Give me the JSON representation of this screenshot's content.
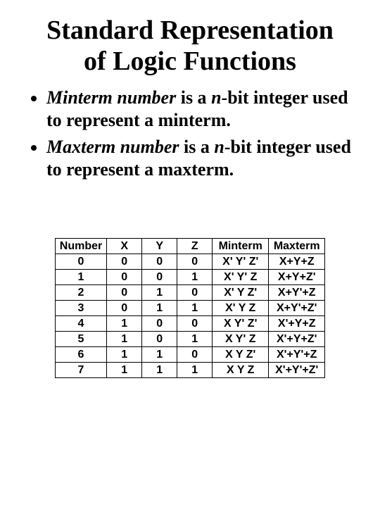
{
  "title_line1": "Standard Representation",
  "title_line2": "of Logic Functions",
  "bullet1": {
    "term": "Minterm number",
    "mid": " is a ",
    "n": "n",
    "rest": "-bit integer used to represent a minterm."
  },
  "bullet2": {
    "term": "Maxterm number",
    "mid": " is a ",
    "n": "n",
    "rest": "-bit integer used to represent a maxterm."
  },
  "chart_data": {
    "type": "table",
    "headers": [
      "Number",
      "X",
      "Y",
      "Z",
      "Minterm",
      "Maxterm"
    ],
    "rows": [
      {
        "Number": "0",
        "X": "0",
        "Y": "0",
        "Z": "0",
        "Minterm": "X' Y' Z'",
        "Maxterm": "X+Y+Z"
      },
      {
        "Number": "1",
        "X": "0",
        "Y": "0",
        "Z": "1",
        "Minterm": "X' Y' Z",
        "Maxterm": "X+Y+Z'"
      },
      {
        "Number": "2",
        "X": "0",
        "Y": "1",
        "Z": "0",
        "Minterm": "X' Y Z'",
        "Maxterm": "X+Y'+Z"
      },
      {
        "Number": "3",
        "X": "0",
        "Y": "1",
        "Z": "1",
        "Minterm": "X' Y Z",
        "Maxterm": "X+Y'+Z'"
      },
      {
        "Number": "4",
        "X": "1",
        "Y": "0",
        "Z": "0",
        "Minterm": "X Y' Z'",
        "Maxterm": "X'+Y+Z"
      },
      {
        "Number": "5",
        "X": "1",
        "Y": "0",
        "Z": "1",
        "Minterm": "X Y' Z",
        "Maxterm": "X'+Y+Z'"
      },
      {
        "Number": "6",
        "X": "1",
        "Y": "1",
        "Z": "0",
        "Minterm": "X Y Z'",
        "Maxterm": "X'+Y'+Z"
      },
      {
        "Number": "7",
        "X": "1",
        "Y": "1",
        "Z": "1",
        "Minterm": "X Y Z",
        "Maxterm": "X'+Y'+Z'"
      }
    ]
  }
}
